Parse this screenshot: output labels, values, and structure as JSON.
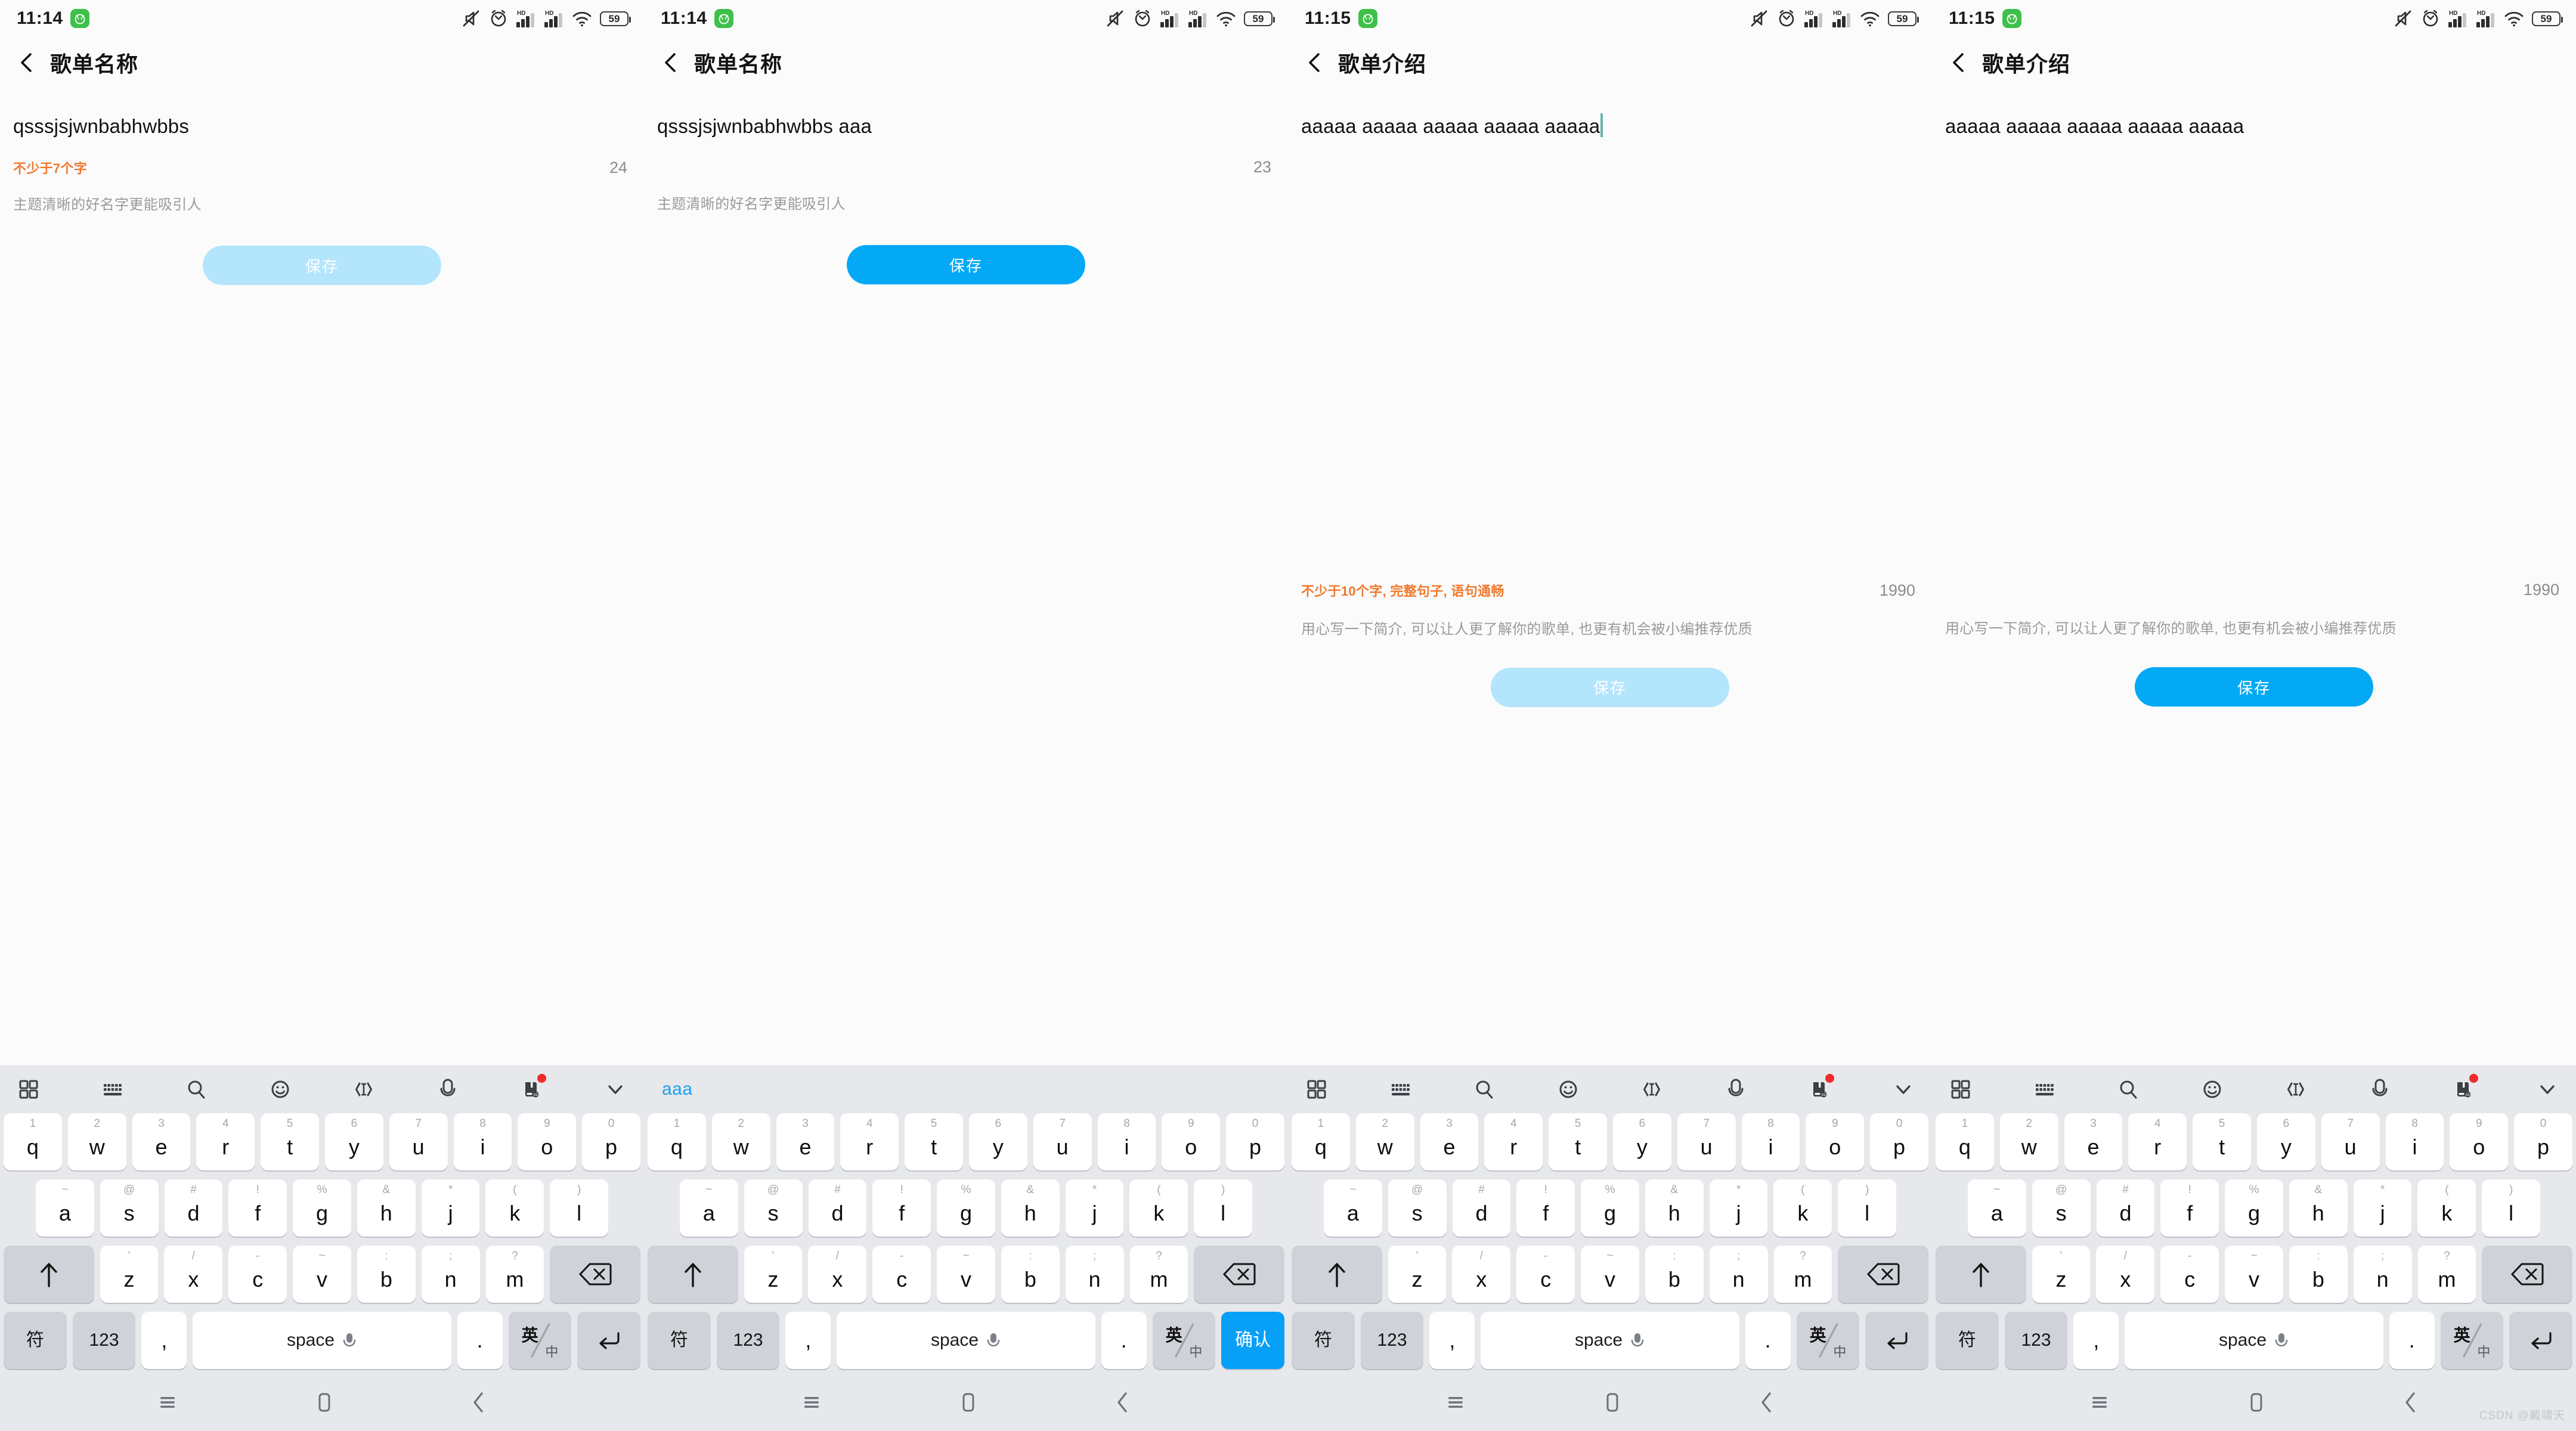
{
  "watermark": "CSDN @戴啸天",
  "colors": {
    "accent": "#03a9f4",
    "accent_disabled": "#b3e5fc",
    "warn": "#f1792c",
    "suggest": "#1ba0ee",
    "caret": "#63b5ab",
    "keyboard_bg": "#e6e8ec",
    "badge_green": "#3fc04a",
    "badge_red": "#f02b2b"
  },
  "status_icons": [
    "mute-icon",
    "alarm-icon",
    "signal-hd-1-icon",
    "signal-hd-2-icon",
    "wifi-icon",
    "battery-icon"
  ],
  "nav": {
    "recents_label": "recents-icon",
    "home_label": "home-icon",
    "back_label": "back-icon"
  },
  "keyboard": {
    "toolbar_icons": [
      "grid-icon",
      "keyboard-icon",
      "search-icon",
      "emoji-icon",
      "text-cursor-icon",
      "mic-icon",
      "dictionary-ad-icon",
      "chevron-down-icon"
    ],
    "row1": [
      {
        "sup": "1",
        "key": "q"
      },
      {
        "sup": "2",
        "key": "w"
      },
      {
        "sup": "3",
        "key": "e"
      },
      {
        "sup": "4",
        "key": "r"
      },
      {
        "sup": "5",
        "key": "t"
      },
      {
        "sup": "6",
        "key": "y"
      },
      {
        "sup": "7",
        "key": "u"
      },
      {
        "sup": "8",
        "key": "i"
      },
      {
        "sup": "9",
        "key": "o"
      },
      {
        "sup": "0",
        "key": "p"
      }
    ],
    "row2": [
      {
        "sup": "~",
        "key": "a"
      },
      {
        "sup": "@",
        "key": "s"
      },
      {
        "sup": "#",
        "key": "d"
      },
      {
        "sup": "!",
        "key": "f"
      },
      {
        "sup": "%",
        "key": "g"
      },
      {
        "sup": "&",
        "key": "h"
      },
      {
        "sup": "*",
        "key": "j"
      },
      {
        "sup": "(",
        "key": "k"
      },
      {
        "sup": ")",
        "key": "l"
      }
    ],
    "row3": [
      {
        "sup": "'",
        "key": "z"
      },
      {
        "sup": "/",
        "key": "x"
      },
      {
        "sup": "-",
        "key": "c"
      },
      {
        "sup": "~",
        "key": "v"
      },
      {
        "sup": ":",
        "key": "b"
      },
      {
        "sup": ";",
        "key": "n"
      },
      {
        "sup": "?",
        "key": "m"
      }
    ],
    "shift_label": "shift-icon",
    "backspace_label": "backspace-icon",
    "row4": {
      "symbol": "符",
      "numeric": "123",
      "comma": ",",
      "space": "space",
      "period": ".",
      "lang_en": "英",
      "lang_cn": "中",
      "enter": "enter-icon",
      "confirm": "确认"
    }
  },
  "screens": [
    {
      "time": "11:14",
      "battery": "59",
      "title": "歌单名称",
      "layout": "name",
      "value": "qsssjsjwnbabhwbbs",
      "caret": false,
      "warn": "不少于7个字",
      "count": "24",
      "tip": "主题清晰的好名字更能吸引人",
      "save_label": "保存",
      "save_enabled": false,
      "kb_mode": "toolbar",
      "suggestion": "",
      "enter_mode": "enter"
    },
    {
      "time": "11:14",
      "battery": "59",
      "title": "歌单名称",
      "layout": "name",
      "value": "qsssjsjwnbabhwbbs aaa",
      "caret": false,
      "warn": "",
      "count": "23",
      "tip": "主题清晰的好名字更能吸引人",
      "save_label": "保存",
      "save_enabled": true,
      "kb_mode": "suggest",
      "suggestion": "aaa",
      "enter_mode": "confirm"
    },
    {
      "time": "11:15",
      "battery": "59",
      "title": "歌单介绍",
      "layout": "desc",
      "value": "aaaaa aaaaa aaaaa aaaaa aaaaa",
      "caret": true,
      "warn": "不少于10个字, 完整句子, 语句通畅",
      "count": "1990",
      "tip": "用心写一下简介, 可以让人更了解你的歌单, 也更有机会被小编推荐优质",
      "save_label": "保存",
      "save_enabled": false,
      "kb_mode": "toolbar",
      "suggestion": "",
      "enter_mode": "enter"
    },
    {
      "time": "11:15",
      "battery": "59",
      "title": "歌单介绍",
      "layout": "desc",
      "value": "aaaaa aaaaa aaaaa aaaaa aaaaa",
      "caret": false,
      "warn": "",
      "count": "1990",
      "tip": "用心写一下简介, 可以让人更了解你的歌单, 也更有机会被小编推荐优质",
      "save_label": "保存",
      "save_enabled": true,
      "kb_mode": "toolbar",
      "suggestion": "",
      "enter_mode": "enter"
    }
  ]
}
